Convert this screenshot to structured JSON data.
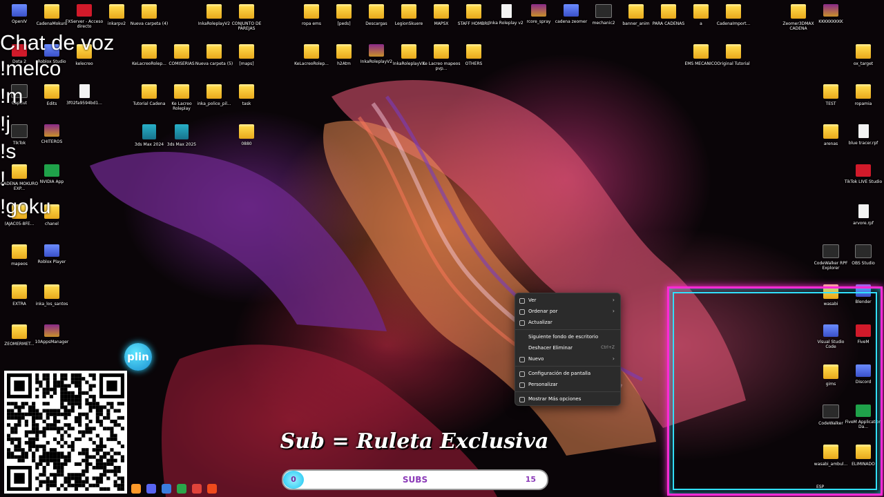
{
  "desktop": {
    "icons": [
      {
        "label": "OpenIV",
        "glyph": "app"
      },
      {
        "label": "CadenaMokuro",
        "glyph": "folder"
      },
      {
        "label": "FXServer - Acceso directo",
        "glyph": "red"
      },
      {
        "label": "inkarpv2",
        "glyph": "folder"
      },
      {
        "label": "Nueva carpeta (4)",
        "glyph": "folder"
      },
      {
        "label": "InkaRoleplayV2",
        "glyph": "folder"
      },
      {
        "label": "CONJUNTO DE PAREJAS",
        "glyph": "folder"
      },
      {
        "label": "ropa ems",
        "glyph": "folder"
      },
      {
        "label": "[peds]",
        "glyph": "folder"
      },
      {
        "label": "Descargas",
        "glyph": "folder"
      },
      {
        "label": "LegionSkuere",
        "glyph": "folder"
      },
      {
        "label": "MAPSX",
        "glyph": "folder"
      },
      {
        "label": "STAFF HOMBRE",
        "glyph": "folder"
      },
      {
        "label": "Inka Roleplay v2",
        "glyph": "doc"
      },
      {
        "label": "rcore_spray",
        "glyph": "winrar"
      },
      {
        "label": "cadena zeomer",
        "glyph": "app"
      },
      {
        "label": "mechanic2",
        "glyph": "dark"
      },
      {
        "label": "banner_anim",
        "glyph": "folder"
      },
      {
        "label": "PARA CADENAS",
        "glyph": "folder"
      },
      {
        "label": "a",
        "glyph": "folder"
      },
      {
        "label": "CadenaImport...",
        "glyph": "folder"
      },
      {
        "label": "Zeomer3DMAX CADENA",
        "glyph": "folder"
      },
      {
        "label": "KKKKKKKKK",
        "glyph": "winrar"
      },
      {
        "label": "Dota 2",
        "glyph": "red"
      },
      {
        "label": "Roblox Studio",
        "glyph": "app"
      },
      {
        "label": "kelecreo",
        "glyph": "folder"
      },
      {
        "label": "KeLacreoRolep...",
        "glyph": "folder"
      },
      {
        "label": "COMISERIAS",
        "glyph": "folder"
      },
      {
        "label": "Nueva carpeta (5)",
        "glyph": "folder"
      },
      {
        "label": "[maps]",
        "glyph": "folder"
      },
      {
        "label": "KeLacreoRolep...",
        "glyph": "folder"
      },
      {
        "label": "h2Atm",
        "glyph": "folder"
      },
      {
        "label": "InkaRoleplayV2",
        "glyph": "winrar"
      },
      {
        "label": "InkaRoleplayV2",
        "glyph": "folder"
      },
      {
        "label": "Ke Lacreo mapeos pvp...",
        "glyph": "folder"
      },
      {
        "label": "OTHERS",
        "glyph": "folder"
      },
      {
        "label": "EMS MECANICO",
        "glyph": "folder"
      },
      {
        "label": "Original Tutorial",
        "glyph": "folder"
      },
      {
        "label": "ox_target",
        "glyph": "folder"
      },
      {
        "label": "CapCut",
        "glyph": "dark"
      },
      {
        "label": "Edits",
        "glyph": "folder"
      },
      {
        "label": "3f02fa9594bd1...",
        "glyph": "doc"
      },
      {
        "label": "Tutorial Cadena",
        "glyph": "folder"
      },
      {
        "label": "Ke Lacreo Roleplay",
        "glyph": "folder"
      },
      {
        "label": "inka_police_pil...",
        "glyph": "folder"
      },
      {
        "label": "task",
        "glyph": "folder"
      },
      {
        "label": "TEST",
        "glyph": "folder"
      },
      {
        "label": "ropamia",
        "glyph": "folder"
      },
      {
        "label": "TikTok",
        "glyph": "dark"
      },
      {
        "label": "CHITEROS",
        "glyph": "winrar"
      },
      {
        "label": "3ds Max 2024",
        "glyph": "max"
      },
      {
        "label": "3ds Max 2025",
        "glyph": "max"
      },
      {
        "label": "0880",
        "glyph": "folder"
      },
      {
        "label": "arenas",
        "glyph": "folder"
      },
      {
        "label": "blue tracer.rpf",
        "glyph": "doc"
      },
      {
        "label": "CADENA MOKURO EXP...",
        "glyph": "folder"
      },
      {
        "label": "NVIDIA App",
        "glyph": "green"
      },
      {
        "label": "TikTok LIVE Studio",
        "glyph": "red"
      },
      {
        "label": "(AJAC05-8FE...",
        "glyph": "folder"
      },
      {
        "label": "chanel",
        "glyph": "folder"
      },
      {
        "label": "arvore.rpf",
        "glyph": "doc"
      },
      {
        "label": "mapeos",
        "glyph": "folder"
      },
      {
        "label": "Roblox Player",
        "glyph": "app"
      },
      {
        "label": "CodeWalker RPF Explorer",
        "glyph": "dark"
      },
      {
        "label": "OBS Studio",
        "glyph": "dark"
      },
      {
        "label": "EXTRA",
        "glyph": "folder"
      },
      {
        "label": "inka_los_santos",
        "glyph": "folder"
      },
      {
        "label": "wasabi",
        "glyph": "folder"
      },
      {
        "label": "Blender",
        "glyph": "app"
      },
      {
        "label": "ZEOMERMET...",
        "glyph": "folder"
      },
      {
        "label": "10AppsManager",
        "glyph": "winrar"
      },
      {
        "label": "Visual Studio Code",
        "glyph": "app"
      },
      {
        "label": "FiveM",
        "glyph": "red"
      },
      {
        "label": "gims",
        "glyph": "folder"
      },
      {
        "label": "Discord",
        "glyph": "app"
      },
      {
        "label": "CodeWalker",
        "glyph": "dark"
      },
      {
        "label": "FiveM Application Da...",
        "glyph": "green"
      },
      {
        "label": "wasabi_ambul...",
        "glyph": "folder"
      },
      {
        "label": "ELIMINADO",
        "glyph": "folder"
      }
    ]
  },
  "chat": {
    "title": "Chat de voz",
    "commands": [
      "!melco",
      "!m",
      "!j",
      "!s",
      "!",
      "!goku"
    ]
  },
  "plin_badge": "plin",
  "context_menu": {
    "items": [
      {
        "label": "Ver",
        "arrow": "›",
        "shortcut": ""
      },
      {
        "label": "Ordenar por",
        "arrow": "›",
        "shortcut": ""
      },
      {
        "label": "Actualizar",
        "arrow": "",
        "shortcut": ""
      },
      {
        "label": "Siguiente fondo de escritorio",
        "arrow": "",
        "shortcut": ""
      },
      {
        "label": "Deshacer Eliminar",
        "arrow": "",
        "shortcut": "Ctrl+Z"
      },
      {
        "label": "Nuevo",
        "arrow": "›",
        "shortcut": ""
      },
      {
        "label": "Configuración de pantalla",
        "arrow": "",
        "shortcut": ""
      },
      {
        "label": "Personalizar",
        "arrow": "",
        "shortcut": ""
      },
      {
        "label": "Mostrar Más opciones",
        "arrow": "",
        "shortcut": ""
      }
    ]
  },
  "overlay": {
    "subtitle": "Sub = Ruleta Exclusiva",
    "subs_current": "0",
    "subs_label": "SUBS",
    "subs_goal": "15",
    "subs_progress": 0.0
  },
  "tray": {
    "lang": "ESP"
  },
  "colors": {
    "frame_pink": "#ff2bd6",
    "frame_cyan": "#31e0ff",
    "subs_text": "#8b3ab8"
  }
}
